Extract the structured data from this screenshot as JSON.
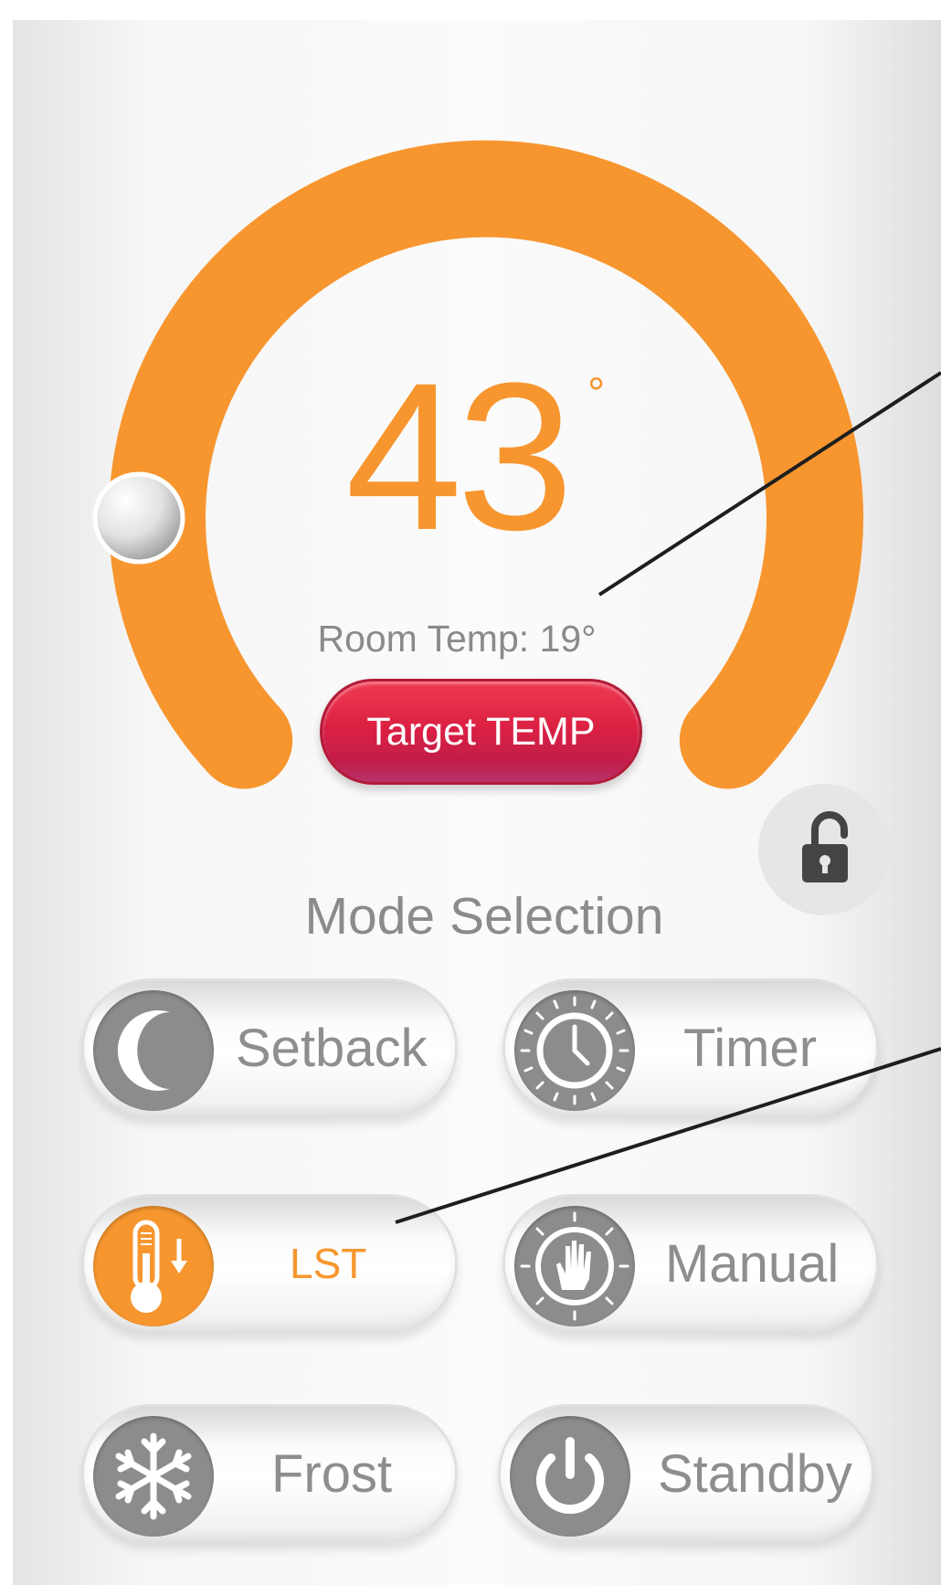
{
  "thermostat": {
    "target_value": "43",
    "degree_symbol": "°",
    "room_temp_label": "Room Temp: 19°",
    "target_button_label": "Target TEMP",
    "lock_state": "unlocked"
  },
  "modes": {
    "title": "Mode Selection",
    "items": [
      {
        "id": "setback",
        "label": "Setback",
        "icon": "moon-icon",
        "active": false
      },
      {
        "id": "timer",
        "label": "Timer",
        "icon": "clock-icon",
        "active": false
      },
      {
        "id": "lst",
        "label": "LST",
        "icon": "thermometer-down-icon",
        "active": true
      },
      {
        "id": "manual",
        "label": "Manual",
        "icon": "hand-icon",
        "active": false
      },
      {
        "id": "frost",
        "label": "Frost",
        "icon": "snowflake-icon",
        "active": false
      },
      {
        "id": "standby",
        "label": "Standby",
        "icon": "power-icon",
        "active": false
      }
    ]
  },
  "colors": {
    "accent": "#f7962f",
    "target_button": "#dc2143",
    "icon_gray": "#8c8c8c",
    "label_gray": "#8e8e8e"
  }
}
